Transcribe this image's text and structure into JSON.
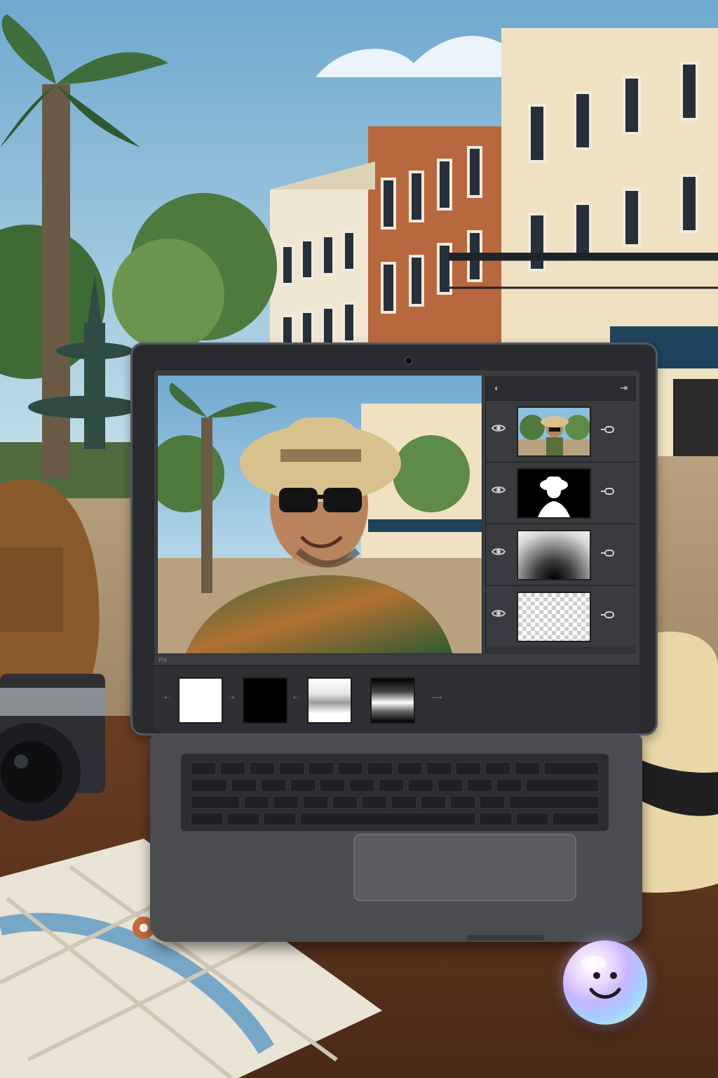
{
  "scene": {
    "description_free": true
  },
  "editor": {
    "layers_panel": {
      "header_left_icon": "panel-options-icon",
      "header_right_icon": "collapse-icon",
      "layers": [
        {
          "name": "photo",
          "thumb": "photo",
          "visible": true
        },
        {
          "name": "mask",
          "thumb": "silhouette-mask",
          "visible": true
        },
        {
          "name": "gradient",
          "thumb": "radial-gradient",
          "visible": true
        },
        {
          "name": "empty",
          "thumb": "transparent-checker",
          "visible": true
        }
      ]
    },
    "strip": {
      "label": "Pnt",
      "swatches": [
        "white",
        "black",
        "white-gradient",
        "black-gradient"
      ]
    }
  },
  "colors": {
    "sky": "#7fb7d6",
    "brick": "#b7683f",
    "cream": "#efe1c2",
    "awning": "#20435d",
    "desk": "#6b3c20",
    "laptop": "#2a2b2e"
  }
}
